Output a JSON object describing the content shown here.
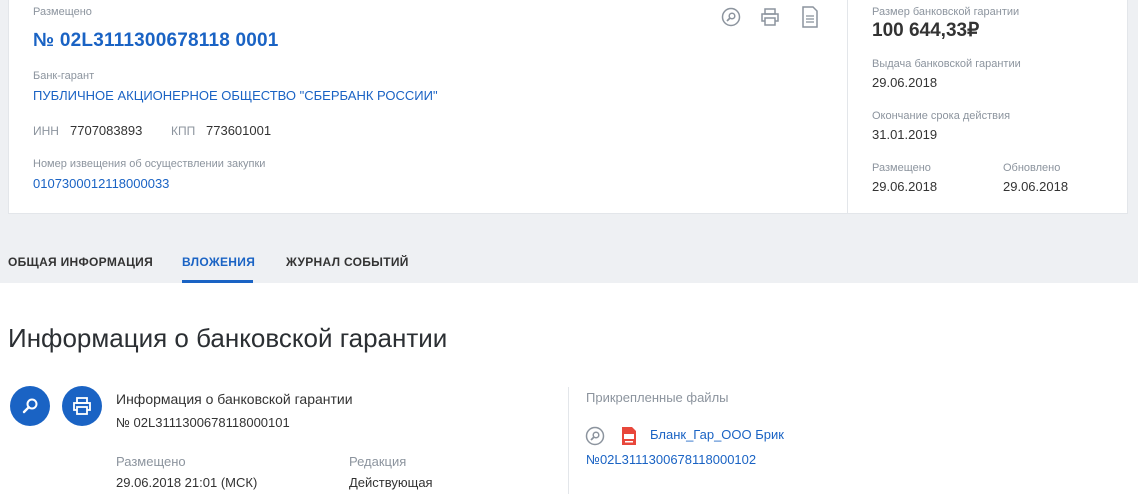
{
  "card": {
    "placed_label": "Размещено",
    "registry_number": "№ 02L3111300678118 0001",
    "bank_label": "Банк-гарант",
    "bank_name": "ПУБЛИЧНОЕ АКЦИОНЕРНОЕ ОБЩЕСТВО \"СБЕРБАНК РОССИИ\"",
    "inn_label": "ИНН",
    "inn_value": "7707083893",
    "kpp_label": "КПП",
    "kpp_value": "773601001",
    "notice_label": "Номер извещения об осуществлении закупки",
    "notice_number": "0107300012118000033",
    "icons": [
      "search-icon",
      "print-icon",
      "document-icon"
    ]
  },
  "summary": {
    "amount_label": "Размер банковской гарантии",
    "amount_value": "100 644,33₽",
    "issue_label": "Выдача банковской гарантии",
    "issue_date": "29.06.2018",
    "end_label": "Окончание срока действия",
    "end_date": "31.01.2019",
    "placed_label": "Размещено",
    "placed_date": "29.06.2018",
    "updated_label": "Обновлено",
    "updated_date": "29.06.2018"
  },
  "tabs": [
    {
      "label": "ОБЩАЯ ИНФОРМАЦИЯ",
      "active": false
    },
    {
      "label": "ВЛОЖЕНИЯ",
      "active": true
    },
    {
      "label": "ЖУРНАЛ СОБЫТИЙ",
      "active": false
    }
  ],
  "content": {
    "title": "Информация о банковской гарантии",
    "doc_title": "Информация о банковской гарантии",
    "doc_number": "№ 02L3111300678118000101",
    "placed_label": "Размещено",
    "placed_value": "29.06.2018 21:01 (МСК)",
    "edition_label": "Редакция",
    "edition_value": "Действующая",
    "attached_label": "Прикрепленные файлы",
    "file_name": "Бланк_Гар_ООО Брик",
    "file_number": "№02L3111300678118000102"
  },
  "colors": {
    "accent": "#1a63c4",
    "background": "#eef0f3",
    "pdf_red": "#e8473b"
  }
}
